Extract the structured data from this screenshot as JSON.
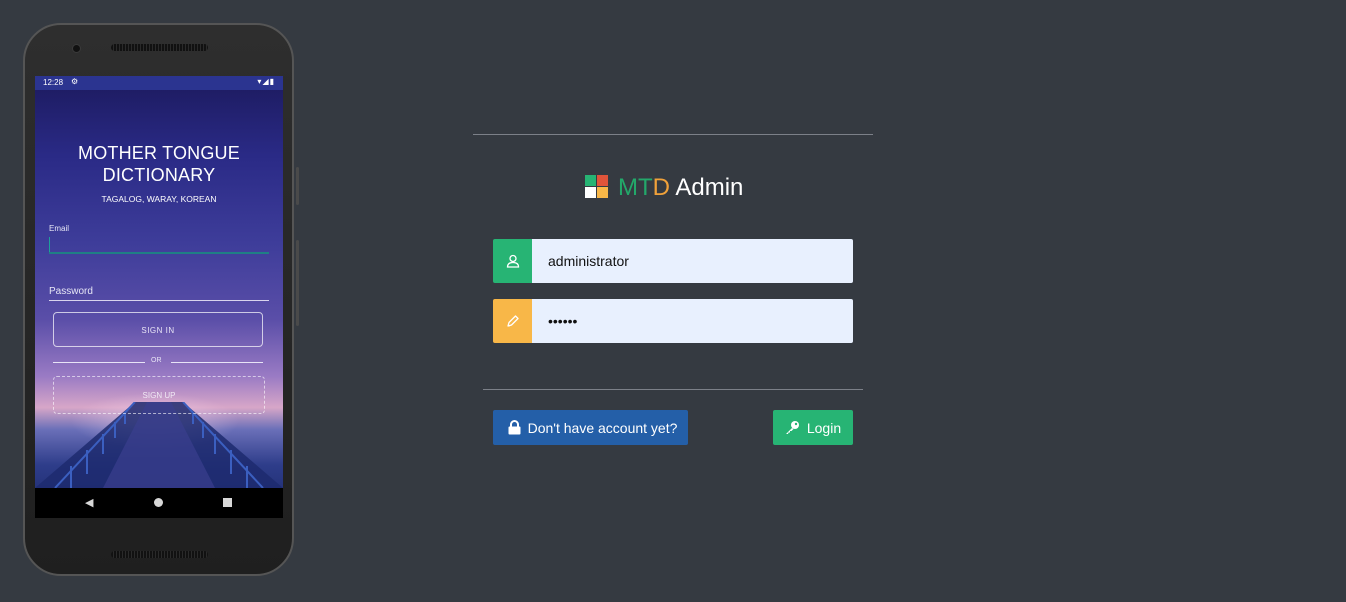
{
  "phone": {
    "status_time": "12:28",
    "app_title_line1": "MOTHER TONGUE",
    "app_title_line2": "DICTIONARY",
    "app_subtitle": "TAGALOG, WARAY, KOREAN",
    "email_label": "Email",
    "password_label": "Password",
    "signin_label": "SIGN IN",
    "or_label": "OR",
    "signup_label": "SIGN UP"
  },
  "brand": {
    "m": "M",
    "t": "T",
    "d": "D",
    "admin": " Admin",
    "colors": {
      "green": "#23a86a",
      "orange": "#f0a13a",
      "white": "#ffffff"
    }
  },
  "login": {
    "username_value": "administrator",
    "password_value": "••••••",
    "username_icon": "user-icon",
    "password_icon": "pencil-icon",
    "signup_button": "Don't have account yet?",
    "login_button": "Login"
  },
  "colors": {
    "background": "#353a41",
    "green": "#27b474",
    "orange": "#f8b748",
    "blue": "#245fa8",
    "input_bg": "#e8f0fe"
  }
}
